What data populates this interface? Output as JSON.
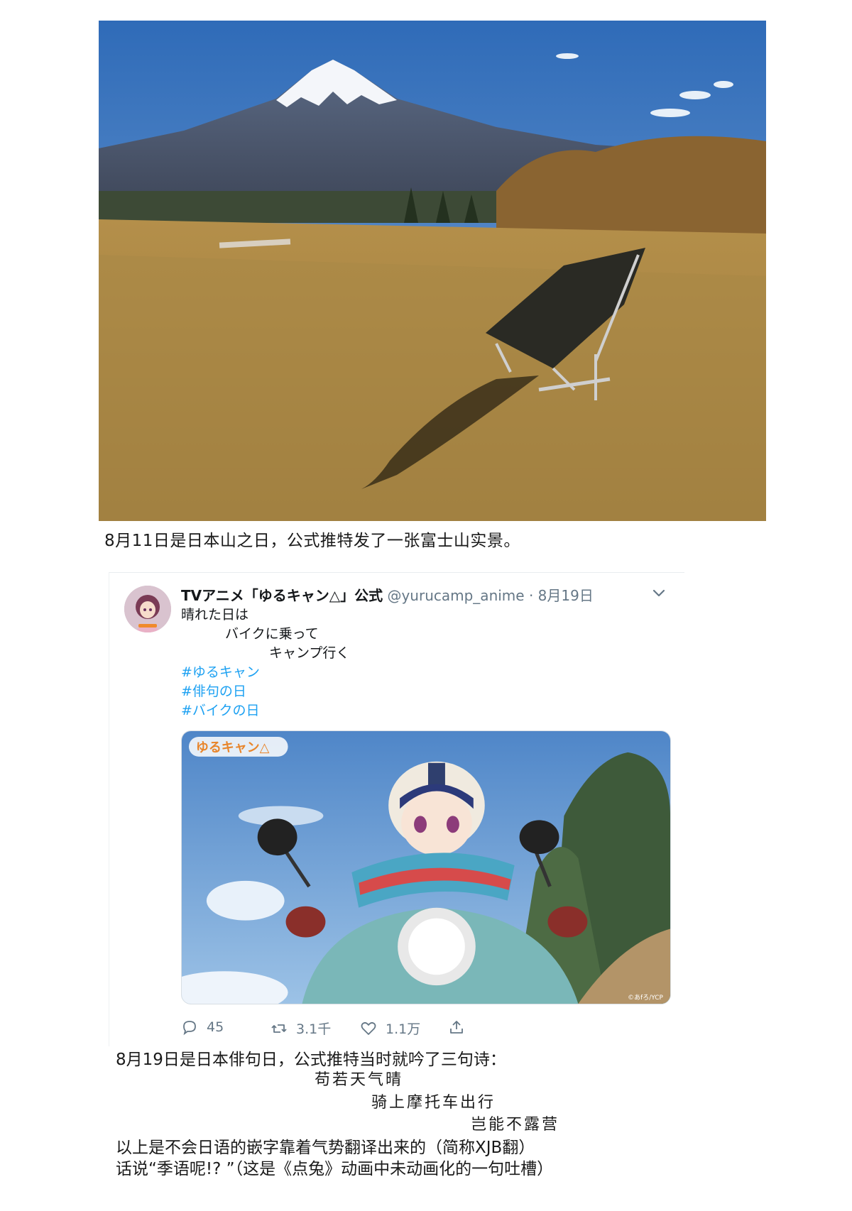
{
  "caption_top": "8月11日是日本山之日，公式推特发了一张富士山实景。",
  "tweet": {
    "name": "TVアニメ「ゆるキャン△」公式",
    "handle": "@yurucamp_anime",
    "dot": "·",
    "date": "8月19日",
    "lines": [
      "晴れた日は",
      "バイクに乗って",
      "キャンプ行く"
    ],
    "hashtags": [
      "#ゆるキャン",
      "#俳句の日",
      "#バイクの日"
    ],
    "media_logo": "ゆるキャン△",
    "media_credit": "©あfろ/YCP",
    "replies": "45",
    "retweets": "3.1千",
    "likes": "1.1万"
  },
  "notes": {
    "intro": "8月19日是日本俳句日，公式推特当时就吟了三句诗：",
    "poem": [
      "苟若天气晴",
      "骑上摩托车出行",
      "岂能不露营"
    ],
    "line1": "以上是不会日语的嵌字靠着气势翻译出来的（简称XJB翻）",
    "line2": "话说“季语呢!? ”（这是《点兔》动画中未动画化的一句吐槽）"
  }
}
